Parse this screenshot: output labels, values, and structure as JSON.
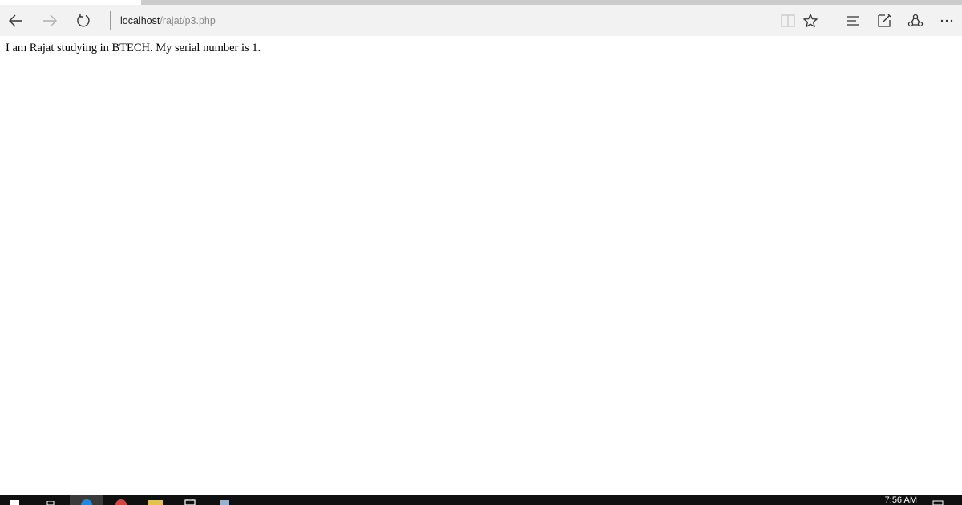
{
  "browser": {
    "address": {
      "host": "localhost",
      "path": "/rajat/p3.php"
    },
    "icons": {
      "back": "back-arrow-icon",
      "forward": "forward-arrow-icon",
      "refresh": "refresh-icon",
      "reading_view": "reading-view-icon",
      "favorite": "star-icon",
      "hub": "hub-icon",
      "web_note": "web-note-icon",
      "share": "share-icon",
      "more": "more-icon"
    }
  },
  "page": {
    "text": "I am Rajat studying in BTECH. My serial number is 1."
  },
  "taskbar": {
    "clock": "7:56 AM"
  }
}
